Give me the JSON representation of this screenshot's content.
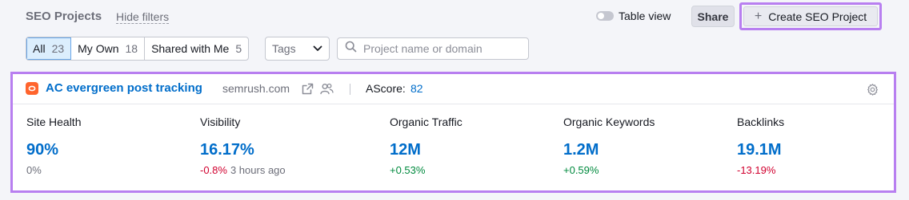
{
  "header": {
    "title": "SEO Projects",
    "hide_filters": "Hide filters",
    "table_view": "Table view",
    "share": "Share",
    "create_project": "Create SEO Project"
  },
  "filters": {
    "segments": [
      {
        "label": "All",
        "count": "23",
        "active": true
      },
      {
        "label": "My Own",
        "count": "18",
        "active": false
      },
      {
        "label": "Shared with Me",
        "count": "5",
        "active": false
      }
    ],
    "tags_label": "Tags",
    "search_placeholder": "Project name or domain",
    "search_value": ""
  },
  "project": {
    "name": "AC evergreen post tracking",
    "domain": "semrush.com",
    "ascore_label": "AScore:",
    "ascore_value": "82",
    "metrics": [
      {
        "label": "Site Health",
        "value": "90%",
        "change": "0%",
        "change_type": "neutral",
        "time": ""
      },
      {
        "label": "Visibility",
        "value": "16.17%",
        "change": "-0.8%",
        "change_type": "negative",
        "time": "3 hours ago"
      },
      {
        "label": "Organic Traffic",
        "value": "12M",
        "change": "+0.53%",
        "change_type": "positive",
        "time": ""
      },
      {
        "label": "Organic Keywords",
        "value": "1.2M",
        "change": "+0.59%",
        "change_type": "positive",
        "time": ""
      },
      {
        "label": "Backlinks",
        "value": "19.1M",
        "change": "-13.19%",
        "change_type": "negative",
        "time": ""
      }
    ]
  },
  "icons": {
    "toggle": "toggle-icon",
    "plus": "plus-icon",
    "tags_chevron": "chevron-down-icon",
    "search": "search-icon",
    "favicon": "semrush-logo-icon",
    "external": "external-link-icon",
    "users": "users-icon",
    "settings": "gear-icon"
  },
  "colors": {
    "accent_blue": "#006dca",
    "highlight_purple": "#b87ff0",
    "negative": "#d1002f",
    "positive": "#008a3e",
    "brand_orange": "#ff642d"
  }
}
